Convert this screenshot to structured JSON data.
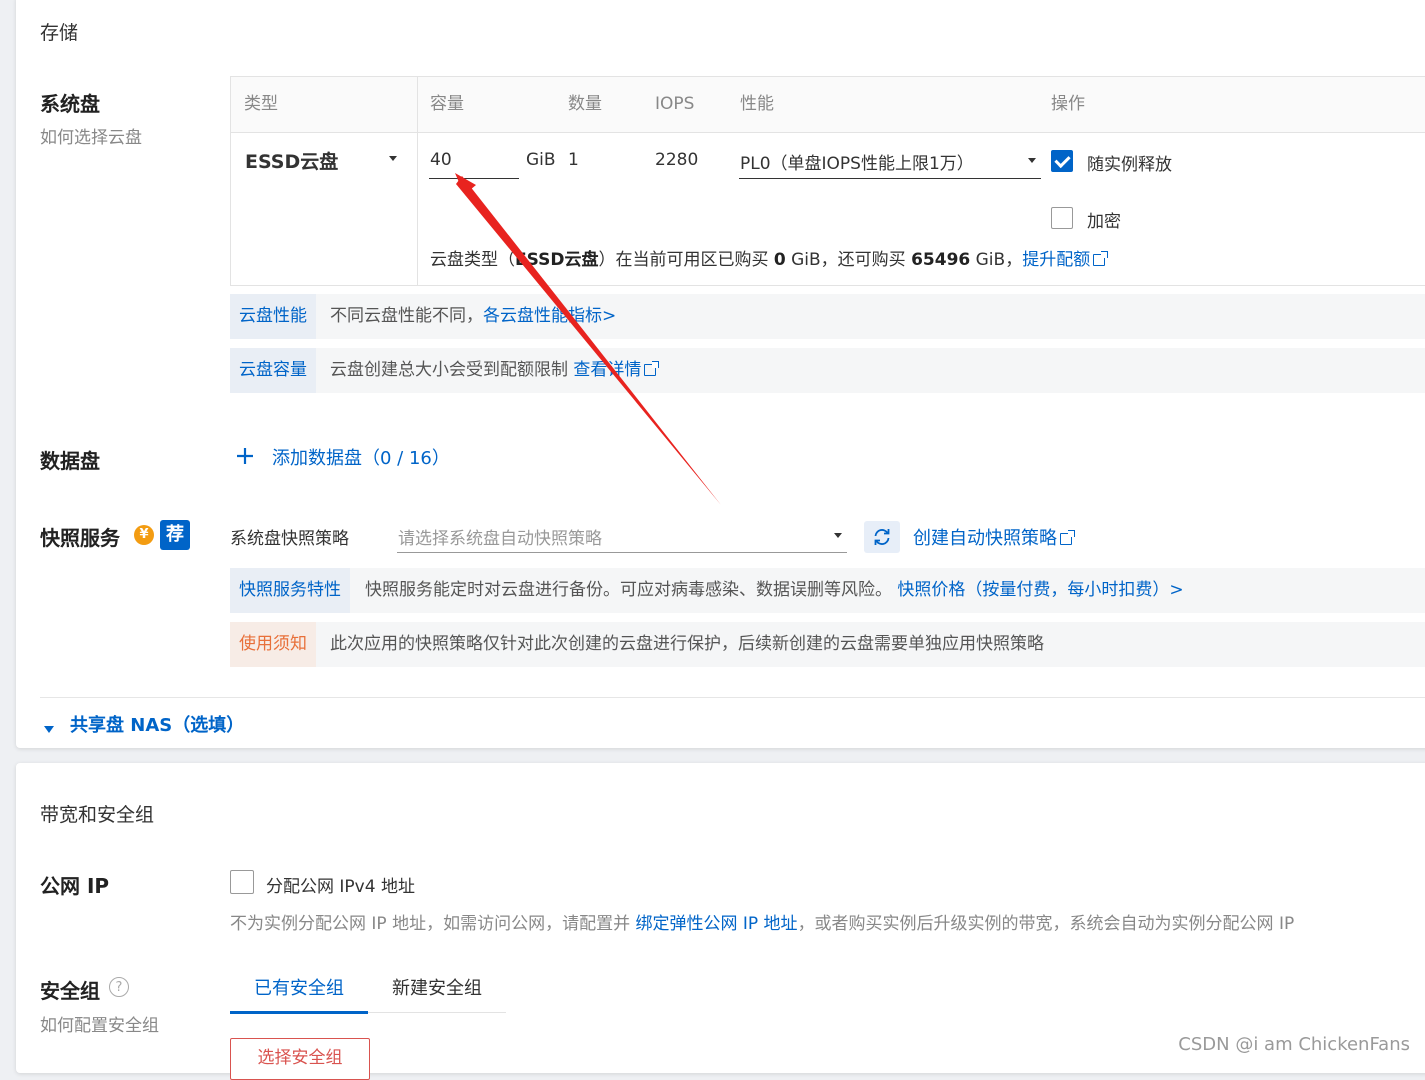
{
  "storage": {
    "section_title": "存储",
    "system_disk": {
      "title": "系统盘",
      "help_link": "如何选择云盘",
      "columns": [
        "类型",
        "容量",
        "数量",
        "IOPS",
        "性能",
        "操作"
      ],
      "row": {
        "type": "ESSD云盘",
        "capacity": "40",
        "unit": "GiB",
        "quantity": "1",
        "iops": "2280",
        "performance": "PL0（单盘IOPS性能上限1万）",
        "release_with_instance": {
          "label": "随实例释放",
          "checked": true
        },
        "encrypt": {
          "label": "加密",
          "checked": false
        }
      },
      "quota_note": {
        "p1": "云盘类型（",
        "type": "ESSD云盘",
        "p2": "）在当前可用区已购买 ",
        "bought": "0",
        "p3": " GiB，还可购买 ",
        "available": "65496",
        "p4": " GiB，",
        "link": "提升配额"
      }
    },
    "info_perf": {
      "tag": "云盘性能",
      "text": "不同云盘性能不同，",
      "link": "各云盘性能指标>"
    },
    "info_capacity": {
      "tag": "云盘容量",
      "text": "云盘创建总大小会受到配额限制 ",
      "link": "查看详情"
    },
    "data_disk": {
      "title": "数据盘",
      "add_label": "添加数据盘（0 / 16）"
    },
    "snapshot": {
      "title": "快照服务",
      "badge_yuan": "¥",
      "badge_rec": "荐",
      "policy_label": "系统盘快照策略",
      "policy_placeholder": "请选择系统盘自动快照策略",
      "create_link": "创建自动快照策略",
      "feature": {
        "tag": "快照服务特性",
        "text": "快照服务能定时对云盘进行备份。可应对病毒感染、数据误删等风险。",
        "link": "快照价格（按量付费，每小时扣费）>"
      },
      "notice": {
        "tag": "使用须知",
        "text": "此次应用的快照策略仅针对此次创建的云盘进行保护，后续新创建的云盘需要单独应用快照策略"
      }
    },
    "nas": {
      "label": "共享盘 NAS（选填）"
    }
  },
  "network": {
    "section_title": "带宽和安全组",
    "public_ip": {
      "title": "公网 IP",
      "checkbox_label": "分配公网 IPv4 地址",
      "checked": false,
      "desc_p1": "不为实例分配公网 IP 地址，如需访问公网，请配置并 ",
      "desc_link": "绑定弹性公网 IP 地址",
      "desc_p2": "，或者购买实例后升级实例的带宽，系统会自动为实例分配公网 IP"
    },
    "security_group": {
      "title": "安全组",
      "help_link": "如何配置安全组",
      "help_icon": "?",
      "tabs": [
        {
          "label": "已有安全组",
          "active": true
        },
        {
          "label": "新建安全组",
          "active": false
        }
      ],
      "select_button": "选择安全组"
    }
  },
  "watermark": "CSDN @i am ChickenFans",
  "colors": {
    "accent": "#0064c8",
    "annotation_arrow": "#e8231f",
    "warn": "#e8703a"
  }
}
